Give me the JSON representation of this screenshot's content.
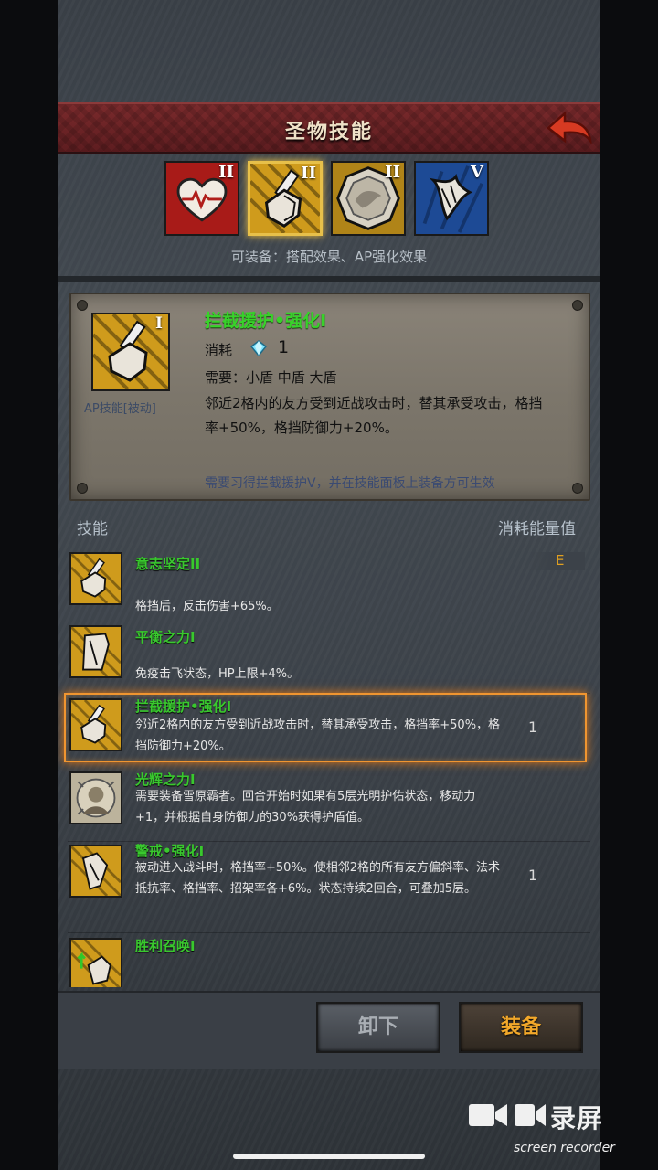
{
  "header": {
    "title": "圣物技能",
    "back_icon": "back-arrow-icon"
  },
  "relics": [
    {
      "icon": "heart-relic-icon",
      "level": "II",
      "bg": "#c0201c"
    },
    {
      "icon": "shield-sword-relic-icon",
      "level": "II",
      "bg": "#d9a420",
      "selected": true
    },
    {
      "icon": "coin-relic-icon",
      "level": "II",
      "bg": "#b98a1a"
    },
    {
      "icon": "wing-relic-icon",
      "level": "V",
      "bg": "#1f4e9a"
    }
  ],
  "equip_hint": "可装备：搭配效果、AP强化效果",
  "detail": {
    "level": "I",
    "type_label": "AP技能[被动]",
    "name": "拦截援护•强化I",
    "cost_label": "消耗",
    "cost_value": "1",
    "require": "需要：小盾 中盾 大盾",
    "description": "邻近2格内的友方受到近战攻击时，替其承受攻击，格挡率+50%，格挡防御力+20%。",
    "note": "需要习得拦截援护V，并在技能面板上装备方可生效"
  },
  "list_header": {
    "left": "技能",
    "right": "消耗能量值"
  },
  "skills": [
    {
      "name": "意志坚定II",
      "desc": "格挡后，反击伤害+65%。",
      "cost": "E"
    },
    {
      "name": "平衡之力I",
      "desc": "免疫击飞状态，HP上限+4%。",
      "cost": ""
    },
    {
      "name": "拦截援护•强化I",
      "desc": "邻近2格内的友方受到近战攻击时，替其承受攻击，格挡率+50%，格挡防御力+20%。",
      "cost": "1"
    },
    {
      "name": "光辉之力I",
      "desc": "需要装备雪原霸者。回合开始时如果有5层光明护佑状态，移动力+1，并根据自身防御力的30%获得护盾值。",
      "cost": ""
    },
    {
      "name": "警戒•强化I",
      "desc": "被动进入战斗时，格挡率+50%。使相邻2格的所有友方偏斜率、法术抵抗率、格挡率、招架率各+6%。状态持续2回合，可叠加5层。",
      "cost": "1"
    },
    {
      "name": "胜利召唤I",
      "desc": "",
      "cost": ""
    }
  ],
  "buttons": {
    "unequip": "卸下",
    "equip": "装备"
  },
  "watermark": {
    "title": "录屏",
    "subtitle": "screen recorder"
  }
}
